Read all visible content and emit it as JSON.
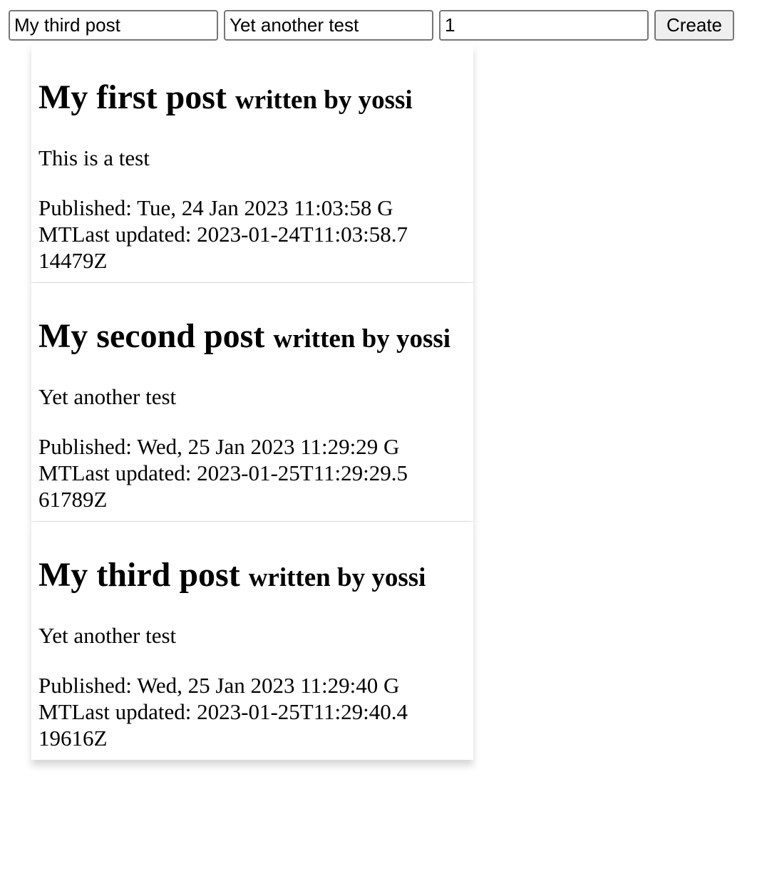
{
  "form": {
    "title_value": "My third post",
    "body_value": "Yet another test",
    "author_id_value": "1",
    "create_label": "Create"
  },
  "posts": [
    {
      "title": "My first post",
      "author": "written by yossi",
      "body": "This is a test",
      "meta": "Published: Tue, 24 Jan 2023 11:03:58 GMTLast updated: 2023-01-24T11:03:58.714479Z"
    },
    {
      "title": "My second post",
      "author": "written by yossi",
      "body": "Yet another test",
      "meta": "Published: Wed, 25 Jan 2023 11:29:29 GMTLast updated: 2023-01-25T11:29:29.561789Z"
    },
    {
      "title": "My third post",
      "author": "written by yossi",
      "body": "Yet another test",
      "meta": "Published: Wed, 25 Jan 2023 11:29:40 GMTLast updated: 2023-01-25T11:29:40.419616Z"
    }
  ]
}
